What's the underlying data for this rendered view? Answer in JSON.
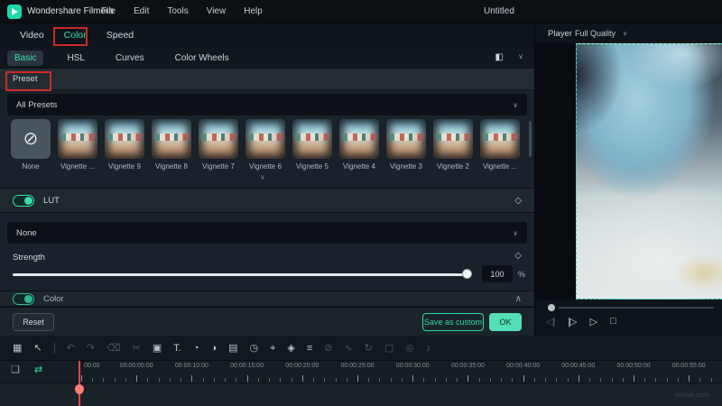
{
  "app": {
    "title": "Wondershare Filmora",
    "project_title": "Untitled",
    "menus": [
      "File",
      "Edit",
      "Tools",
      "View",
      "Help"
    ]
  },
  "tabs": {
    "items": [
      "Video",
      "Color",
      "Speed"
    ],
    "active": "Color"
  },
  "subtabs": {
    "items": [
      "Basic",
      "HSL",
      "Curves",
      "Color Wheels"
    ],
    "active": "Basic"
  },
  "preset_section": {
    "label": "Preset",
    "dropdown_value": "All Presets"
  },
  "presets": {
    "items": [
      {
        "label": "None",
        "type": "none"
      },
      {
        "label": "Vignette ...",
        "type": "art"
      },
      {
        "label": "Vignette 9",
        "type": "art"
      },
      {
        "label": "Vignette 8",
        "type": "art"
      },
      {
        "label": "Vignette 7",
        "type": "art"
      },
      {
        "label": "Vignette 6",
        "type": "art"
      },
      {
        "label": "Vignette 5",
        "type": "art"
      },
      {
        "label": "Vignette 4",
        "type": "art"
      },
      {
        "label": "Vignette 3",
        "type": "art"
      },
      {
        "label": "Vignette 2",
        "type": "art"
      },
      {
        "label": "Vignette ...",
        "type": "art"
      }
    ]
  },
  "lut": {
    "label": "LUT",
    "toggle_on": true,
    "dropdown_value": "None"
  },
  "strength": {
    "label": "Strength",
    "value": "100",
    "unit": "%"
  },
  "color_section": {
    "label": "Color"
  },
  "buttons": {
    "reset": "Reset",
    "save_as_custom": "Save as custom",
    "ok": "OK"
  },
  "player": {
    "label": "Player",
    "quality": "Full Quality",
    "transport": [
      {
        "name": "previous-frame",
        "glyph": "◁|",
        "dim": true
      },
      {
        "name": "next-frame",
        "glyph": "|▷",
        "dim": false
      },
      {
        "name": "play",
        "glyph": "▷",
        "dim": false
      },
      {
        "name": "stop",
        "glyph": "□",
        "dim": false
      }
    ]
  },
  "timeline": {
    "toolbar": [
      {
        "name": "media-grid",
        "glyph": "▦",
        "dim": false
      },
      {
        "name": "select-tool",
        "glyph": "↖",
        "dim": false
      },
      {
        "name": "divider",
        "glyph": "|",
        "dim": false
      },
      {
        "name": "undo",
        "glyph": "↶",
        "dim": true
      },
      {
        "name": "redo",
        "glyph": "↷",
        "dim": true
      },
      {
        "name": "delete",
        "glyph": "⌫",
        "dim": true
      },
      {
        "name": "split-scissors",
        "glyph": "✂",
        "dim": true
      },
      {
        "name": "crop",
        "glyph": "▣",
        "dim": false
      },
      {
        "name": "text-tool",
        "glyph": "T.",
        "dim": false
      },
      {
        "name": "speed",
        "glyph": "◔",
        "dim": false
      },
      {
        "name": "color-correction",
        "glyph": "◑",
        "dim": false
      },
      {
        "name": "green-screen",
        "glyph": "▤",
        "dim": false
      },
      {
        "name": "timer",
        "glyph": "◷",
        "dim": false
      },
      {
        "name": "motion-track",
        "glyph": "⌖",
        "dim": false
      },
      {
        "name": "keyframe",
        "glyph": "◈",
        "dim": false
      },
      {
        "name": "adjustment",
        "glyph": "≡",
        "dim": false
      },
      {
        "name": "mute",
        "glyph": "⊘",
        "dim": true
      },
      {
        "name": "audio-graph",
        "glyph": "∿",
        "dim": true
      },
      {
        "name": "render-preview",
        "glyph": "↻",
        "dim": true
      },
      {
        "name": "snapshot",
        "glyph": "▢",
        "dim": true
      },
      {
        "name": "audio-sync",
        "glyph": "◎",
        "dim": true
      },
      {
        "name": "audio-note",
        "glyph": "♪",
        "dim": true
      }
    ],
    "ruler_icons": [
      {
        "name": "add-to-track",
        "glyph": "❏"
      },
      {
        "name": "auto-ripple-link",
        "glyph": "⇄"
      }
    ],
    "ruler_labels": [
      "00:00",
      "00:00:05:00",
      "00:00:10:00",
      "00:00:15:00",
      "00:00:20:00",
      "00:00:25:00",
      "00:00:30:00",
      "00:00:35:00",
      "00:00:40:00",
      "00:00:45:00",
      "00:00:50:00",
      "00:00:55:00"
    ],
    "watermark": "wevai.com"
  },
  "icons": {
    "compare_icon": "◧",
    "chevron_down": "∨",
    "chevron_up": "∧",
    "keyframe_diamond": "◇",
    "none_slash": "⊘"
  },
  "colors": {
    "accent": "#2ee0ad",
    "annotation_red": "#cc2a24",
    "playhead_red": "#f2453d",
    "panel_bg": "#19212a"
  }
}
